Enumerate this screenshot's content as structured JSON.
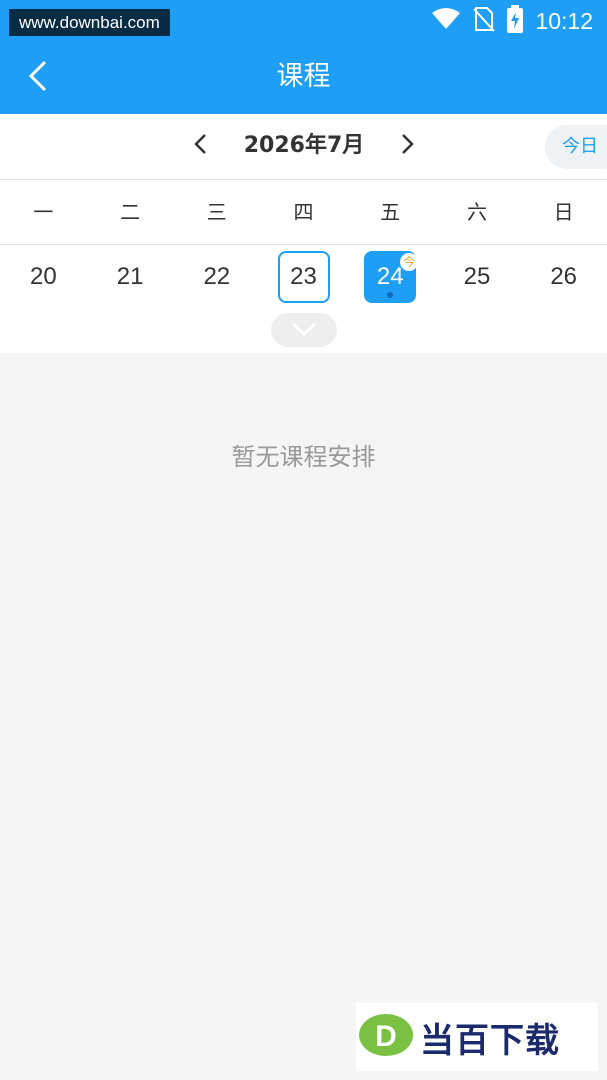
{
  "status_bar": {
    "watermark": "www.downbai.com",
    "time": "10:12"
  },
  "nav": {
    "title": "课程"
  },
  "calendar": {
    "month_label": "2026年7月",
    "today_button": "今日",
    "weekdays": [
      "一",
      "二",
      "三",
      "四",
      "五",
      "六",
      "日"
    ],
    "dates": [
      "20",
      "21",
      "22",
      "23",
      "24",
      "25",
      "26"
    ],
    "selected_date": "23",
    "today_date": "24",
    "today_badge": "今"
  },
  "empty_state": {
    "message": "暂无课程安排"
  },
  "brand": {
    "logo_letter": "D",
    "text": "当百下载"
  },
  "colors": {
    "primary": "#1e9ef4",
    "badge": "#f0a020",
    "logo_green": "#7ac143"
  }
}
